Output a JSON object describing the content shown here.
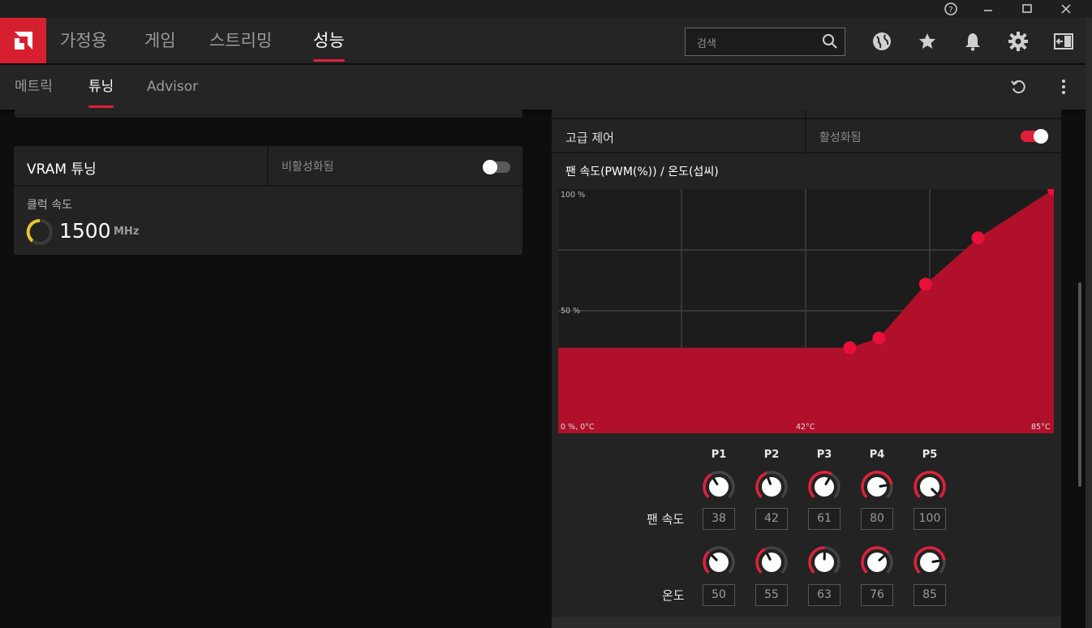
{
  "window": {
    "help_icon": "question-circle-icon",
    "min_icon": "minimize-icon",
    "max_icon": "maximize-icon",
    "close_icon": "close-icon"
  },
  "topnav": {
    "tabs": [
      {
        "label": "가정용",
        "active": false
      },
      {
        "label": "게임",
        "active": false
      },
      {
        "label": "스트리밍",
        "active": false
      },
      {
        "label": "성능",
        "active": true
      }
    ],
    "search_placeholder": "검색",
    "icons": [
      "globe-icon",
      "star-icon",
      "bell-icon",
      "gear-icon",
      "exit-icon"
    ]
  },
  "subnav": {
    "tabs": [
      {
        "label": "메트릭",
        "active": false
      },
      {
        "label": "튜닝",
        "active": true
      },
      {
        "label": "Advisor",
        "active": false
      }
    ]
  },
  "vram": {
    "title": "VRAM 튜닝",
    "status": "비활성화됨",
    "enabled": false,
    "clock_label": "클럭 속도",
    "clock_value": "1500",
    "clock_unit": "MHz",
    "accent": "#e8c233"
  },
  "advanced": {
    "label": "고급 제어",
    "status": "활성화됨",
    "enabled": true
  },
  "fan": {
    "chart_title": "팬 속도(PWM(%)) / 온도(섭씨)",
    "speed_label": "팬 속도",
    "temp_label": "온도",
    "points": [
      "P1",
      "P2",
      "P3",
      "P4",
      "P5"
    ],
    "speed": [
      38,
      42,
      61,
      80,
      100
    ],
    "temp": [
      50,
      55,
      63,
      76,
      85
    ]
  },
  "chart_data": {
    "type": "area",
    "y_top_label": "100 %",
    "y_mid_label": "50 %",
    "x_origin_label": "0 %, 0°C",
    "x_mid_label": "42°C",
    "x_max_label": "85°C",
    "fill": "#b0102a",
    "point_color": "#e8103a",
    "x_range": [
      0,
      85
    ],
    "y_range": [
      0,
      100
    ],
    "flat_value": 35,
    "x": [
      50,
      55,
      63,
      72,
      85
    ],
    "y": [
      35,
      39,
      61,
      80,
      100
    ]
  }
}
